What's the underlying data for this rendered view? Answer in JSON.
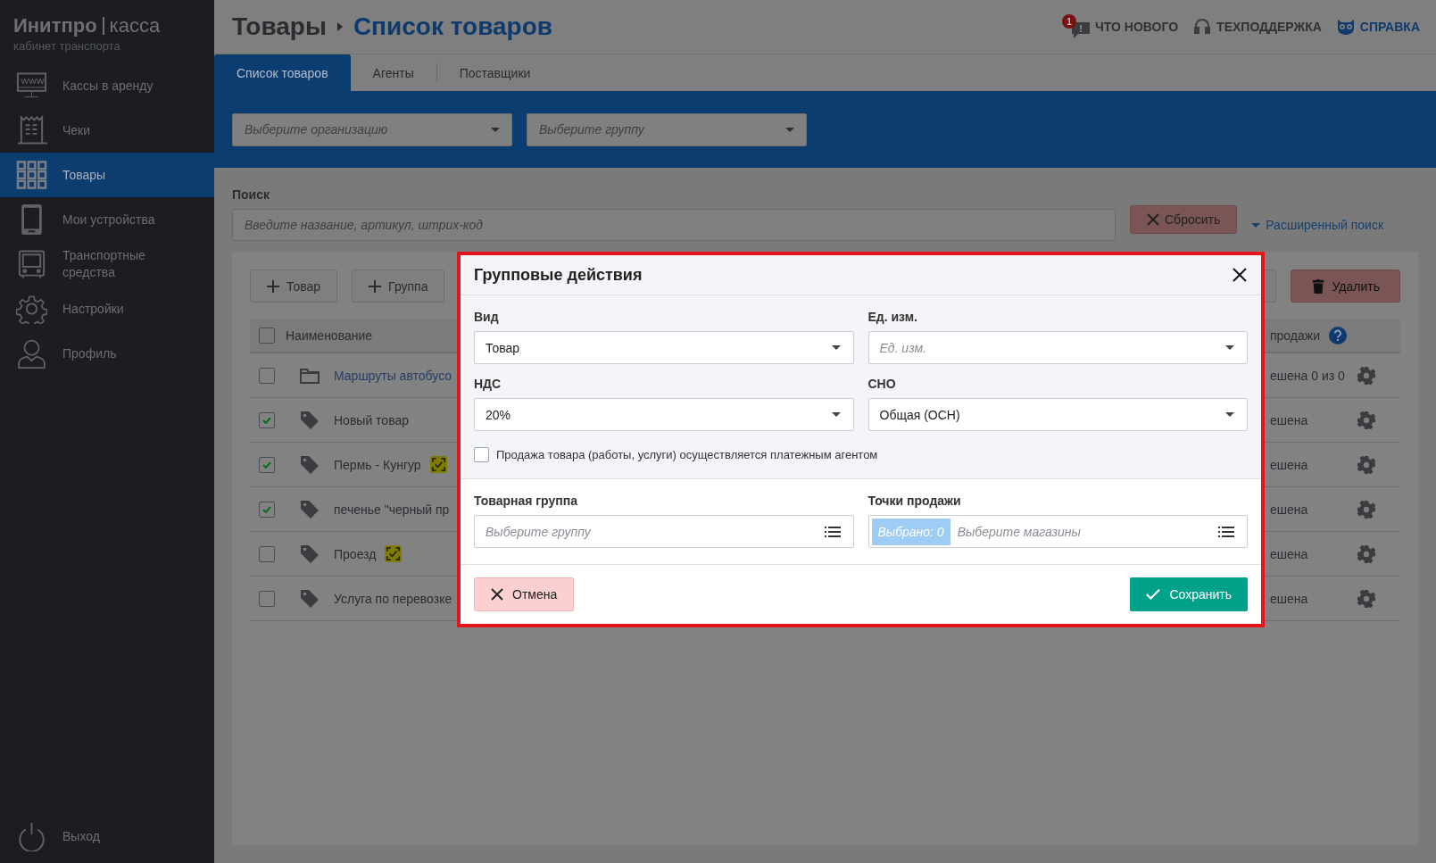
{
  "sidebar": {
    "brand": "Инитпро",
    "brand_product": "касса",
    "subtitle": "кабинет транспорта",
    "items": [
      {
        "label": "Кассы в аренду",
        "selected": false
      },
      {
        "label": "Чеки",
        "selected": false
      },
      {
        "label": "Товары",
        "selected": true
      },
      {
        "label": "Мои устройства",
        "selected": false
      },
      {
        "label": "Транспортные средства",
        "selected": false
      },
      {
        "label": "Настройки",
        "selected": false
      },
      {
        "label": "Профиль",
        "selected": false
      }
    ],
    "logout": "Выход"
  },
  "header": {
    "breadcrumb": [
      "Товары",
      "Список товаров"
    ],
    "links": [
      {
        "label": "ЧТО НОВОГО",
        "badge": "1"
      },
      {
        "label": "ТЕХПОДДЕРЖКА"
      },
      {
        "label": "СПРАВКА"
      }
    ]
  },
  "tabs": [
    {
      "label": "Список товаров",
      "selected": true
    },
    {
      "label": "Агенты",
      "selected": false
    },
    {
      "label": "Поставщики",
      "selected": false
    }
  ],
  "filters": [
    {
      "placeholder": "Выберите организацию"
    },
    {
      "placeholder": "Выберите группу"
    }
  ],
  "search": {
    "label": "Поиск",
    "placeholder": "Введите название, артикул, штрих-код",
    "reset": "Сбросить",
    "advanced": "Расширенный поиск"
  },
  "toolbar": {
    "add_buttons": [
      "Товар",
      "Группа"
    ],
    "delete": "Удалить"
  },
  "table": {
    "header": {
      "checked": false,
      "name": "Наименование",
      "column_3": "продажи"
    },
    "rows": [
      {
        "checked": false,
        "kind": "group",
        "name": "Маршруты автобусо",
        "verified": false,
        "column_3": "ешена 0 из 0"
      },
      {
        "checked": true,
        "kind": "item",
        "name": "Новый товар",
        "verified": false,
        "column_3": "ешена"
      },
      {
        "checked": true,
        "kind": "item",
        "name": "Пермь - Кунгур",
        "verified": true,
        "column_3": "ешена"
      },
      {
        "checked": true,
        "kind": "item",
        "name": "печенье \"черный пр",
        "verified": false,
        "column_3": "ешена"
      },
      {
        "checked": false,
        "kind": "item",
        "name": "Проезд",
        "verified": true,
        "column_3": "ешена"
      },
      {
        "checked": false,
        "kind": "item",
        "name": "Услуга по перевозке",
        "verified": false,
        "column_3": "ешена"
      }
    ]
  },
  "modal": {
    "title": "Групповые действия",
    "selects": [
      {
        "label": "Вид",
        "value": "Товар"
      },
      {
        "label": "Ед. изм.",
        "placeholder": "Ед. изм."
      },
      {
        "label": "НДС",
        "value": "20%"
      },
      {
        "label": "СНО",
        "value": "Общая (ОСН)"
      }
    ],
    "agent_checkbox": {
      "label": "Продажа товара (работы, услуги) осуществляется платежным агентом",
      "checked": false
    },
    "group_field": {
      "label": "Товарная группа",
      "placeholder": "Выберите группу"
    },
    "shops_field": {
      "label": "Точки продажи",
      "badge": "Выбрано: 0",
      "placeholder": "Выберите магазины"
    },
    "cancel": "Отмена",
    "save": "Сохранить"
  }
}
